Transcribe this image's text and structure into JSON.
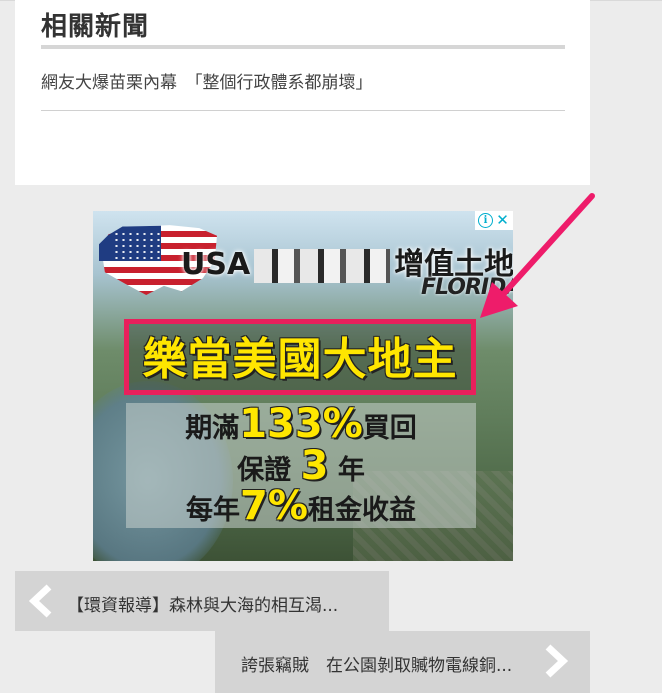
{
  "related_news": {
    "title": "相關新聞",
    "items": [
      {
        "label": "網友大爆苗栗內幕　「整個行政體系都崩壞」"
      }
    ]
  },
  "ad": {
    "header_prefix": "USA",
    "header_suffix": "增值土地",
    "location": "FLORIDA",
    "headline": "樂當美國大地主",
    "line1": {
      "pre": "期滿",
      "big": "133%",
      "post": "買回"
    },
    "line2": {
      "pre": "保證 ",
      "big": "3",
      "post": " 年"
    },
    "line3": {
      "pre": "每年",
      "big": "7%",
      "post": "租金收益"
    },
    "info_icon": "info-icon",
    "close_icon": "close-icon",
    "colors": {
      "headline": "#ffe600",
      "border": "#e8205c",
      "adchoices": "#00aecd"
    }
  },
  "post_nav": {
    "prev_label": "【環資報導】森林與大海的相互渴...",
    "next_label": "誇張竊賊　在公園剝取贓物電線銅..."
  },
  "annotation": {
    "arrow_color": "#ee1c6a"
  }
}
